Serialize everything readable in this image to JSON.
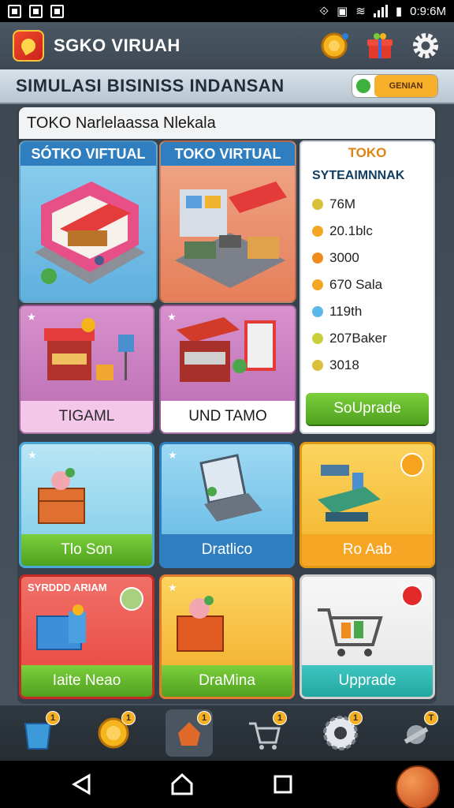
{
  "status_bar": {
    "time": "0:9:6M"
  },
  "app_bar": {
    "title": "SGKO VIRUAH"
  },
  "header": {
    "title": "SIMULASI  BISINISS INDANSAN",
    "toggle_label": "GENIAN"
  },
  "panel": {
    "title": "TOKO Narlelaassa Nlekala"
  },
  "cards": [
    {
      "header": "SÓTKO VIFTUAL"
    },
    {
      "header": "TOKO VIRTUAL"
    },
    {
      "label": "TIGAML"
    },
    {
      "label": "UND TAMO"
    },
    {
      "label": "Tlo Son"
    },
    {
      "label": "Dratlico"
    },
    {
      "label": "Ro Aab"
    },
    {
      "header": "SYRDDD ARIAM",
      "label": "Iaite Neao"
    },
    {
      "label": "DraMina"
    },
    {
      "label": "Upprade"
    }
  ],
  "stats": {
    "heading": "TOKO",
    "subheading": "SYTEAIMNNAK",
    "rows": [
      {
        "value": "76M",
        "color": "#d8c03a"
      },
      {
        "value": "20.1blc",
        "color": "#f2a622"
      },
      {
        "value": "3000",
        "color": "#f08c1e"
      },
      {
        "value": "670 Sala",
        "color": "#f2a622"
      },
      {
        "value": "119th",
        "color": "#5ab9e8"
      },
      {
        "value": "207Baker",
        "color": "#c8cf3a"
      },
      {
        "value": "3018",
        "color": "#d8c03a"
      }
    ],
    "button": "SoUprade"
  },
  "bottom_nav": [
    {
      "icon": "bucket-icon",
      "badge": "1"
    },
    {
      "icon": "coin-icon",
      "badge": "1"
    },
    {
      "icon": "shop-icon",
      "badge": "1"
    },
    {
      "icon": "cart-icon",
      "badge": "1"
    },
    {
      "icon": "gear-icon",
      "badge": "1"
    },
    {
      "icon": "tools-icon",
      "badge": "T"
    }
  ]
}
